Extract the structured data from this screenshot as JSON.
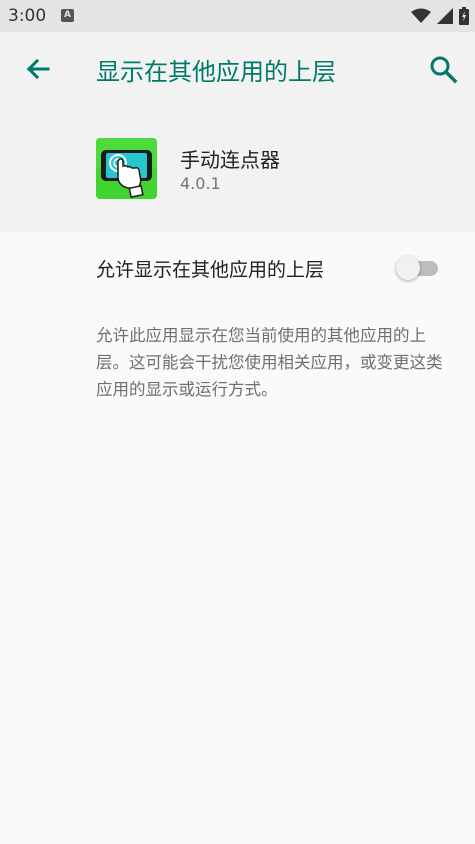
{
  "status_bar": {
    "time": "3:00",
    "notification_icon": "A"
  },
  "header": {
    "title": "显示在其他应用的上层",
    "back_icon": "arrow-left",
    "search_icon": "magnifier"
  },
  "app": {
    "name": "手动连点器",
    "version": "4.0.1"
  },
  "setting": {
    "label": "允许显示在其他应用的上层",
    "enabled": false
  },
  "description": "允许此应用显示在您当前使用的其他应用的上层。这可能会干扰您使用相关应用，或变更这类应用的显示或运行方式。",
  "colors": {
    "accent": "#00796b",
    "app_icon_green": "#3fd42f"
  }
}
